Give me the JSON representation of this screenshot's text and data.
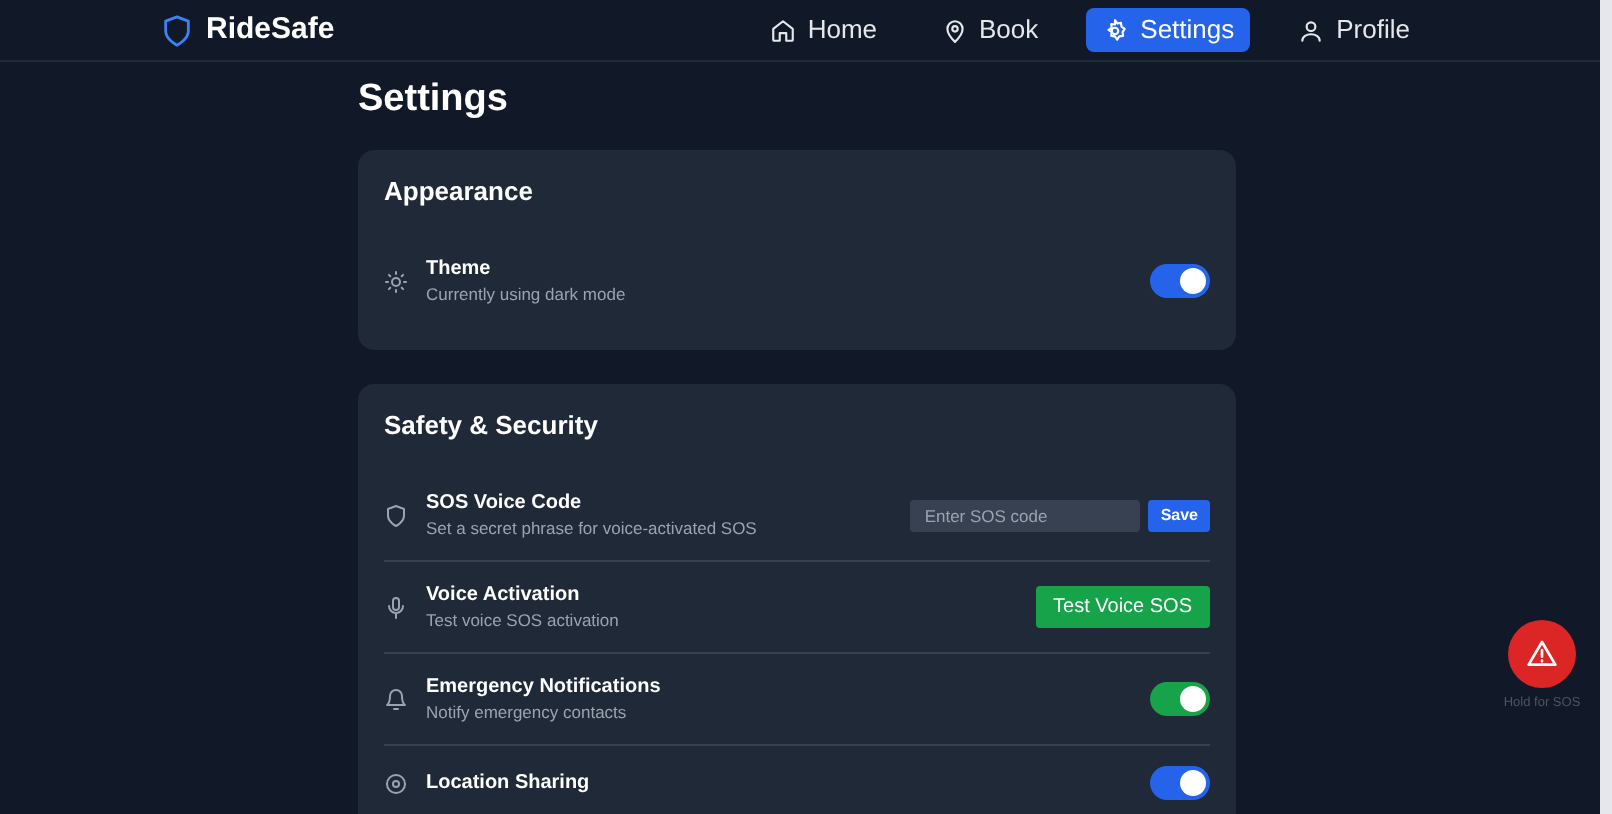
{
  "brand": "RideSafe",
  "nav": [
    {
      "label": "Home",
      "selected": false
    },
    {
      "label": "Book",
      "selected": false
    },
    {
      "label": "Settings",
      "selected": true
    },
    {
      "label": "Profile",
      "selected": false
    }
  ],
  "title": "Settings",
  "sections": [
    {
      "heading": "Appearance",
      "items": [
        {
          "kind": "toggle",
          "label": "Theme",
          "description": "Currently using dark mode",
          "on": true,
          "color": "#2563eb"
        }
      ]
    },
    {
      "heading": "Safety & Security",
      "items": [
        {
          "kind": "input",
          "label": "SOS Voice Code",
          "description": "Set a secret phrase for voice-activated SOS",
          "placeholder": "Enter SOS code",
          "button": "Save"
        },
        {
          "kind": "button",
          "label": "Voice Activation",
          "description": "Test voice SOS activation",
          "button": "Test Voice SOS"
        },
        {
          "kind": "toggle",
          "label": "Emergency Notifications",
          "description": "Notify emergency contacts",
          "on": true,
          "color": "#16a34a"
        },
        {
          "kind": "toggle",
          "label": "Location Sharing",
          "on": true,
          "color": "#2563eb"
        }
      ]
    }
  ],
  "sos": {
    "caption": "Hold for SOS"
  }
}
